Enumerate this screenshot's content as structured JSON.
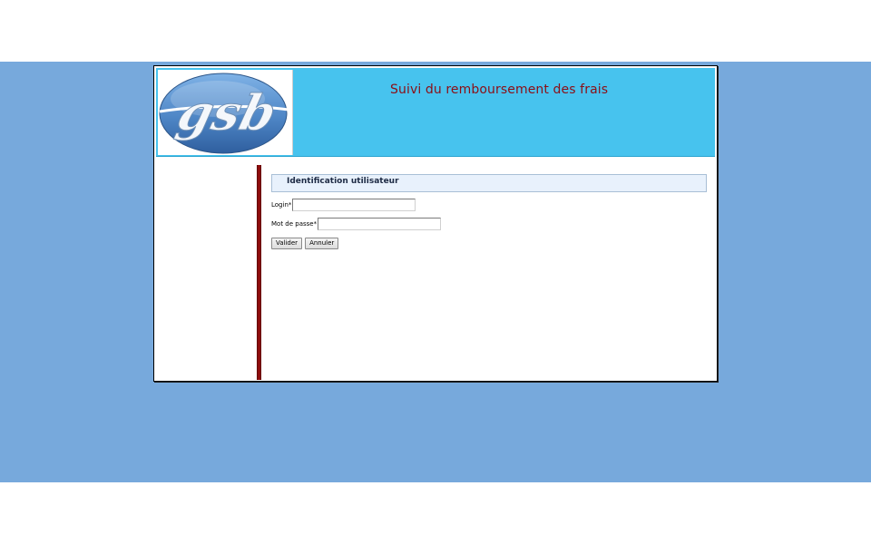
{
  "header": {
    "title": "Suivi du remboursement des frais",
    "logo_text": "gsb"
  },
  "form": {
    "heading": "Identification utilisateur",
    "login_label": "Login*",
    "login_value": "",
    "password_label": "Mot de passe*",
    "password_value": "",
    "submit_label": "Valider",
    "reset_label": "Annuler"
  },
  "colors": {
    "page_background": "#77a9dc",
    "header_background": "#47c3ee",
    "title_color": "#8b0f16",
    "divider_color": "#8b0a0a",
    "heading_background": "#e8f1fc"
  }
}
